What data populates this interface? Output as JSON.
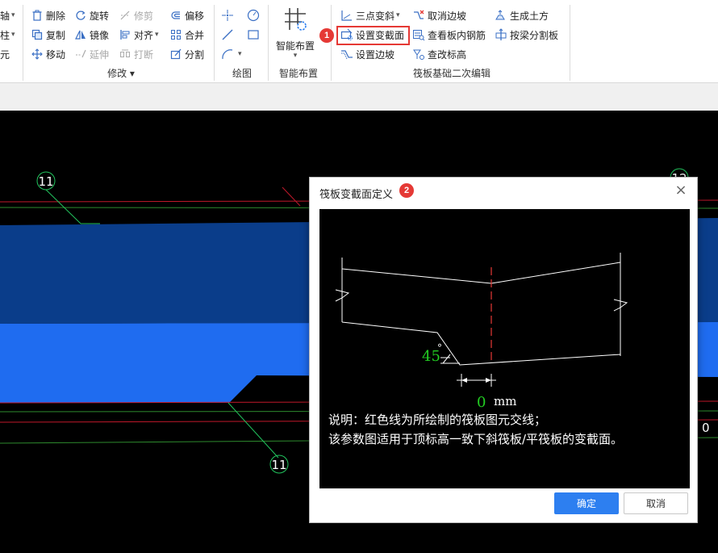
{
  "ribbon": {
    "left_cut_labels": [
      "轴",
      "柱",
      "元"
    ],
    "modify": {
      "delete": "删除",
      "rotate": "旋转",
      "trim": "修剪",
      "offset": "偏移",
      "copy": "复制",
      "mirror": "镜像",
      "align": "对齐",
      "merge": "合并",
      "move": "移动",
      "extend": "延伸",
      "break": "打断",
      "split": "分割",
      "group_label": "修改"
    },
    "draw": {
      "group_label": "绘图"
    },
    "smart": {
      "button_label": "智能布置",
      "group_label": "智能布置"
    },
    "raft_edit": {
      "three_point_slope": "三点变斜",
      "cancel_slope": "取消边坡",
      "generate_earthwork": "生成土方",
      "set_section": "设置变截面",
      "view_rebar": "查看板内钢筋",
      "split_by_beam": "按梁分割板",
      "set_slope": "设置边坡",
      "edit_elevation": "查改标高",
      "group_label": "筏板基础二次编辑"
    },
    "badge_1": "1"
  },
  "canvas": {
    "axis_label_left_top": "11",
    "axis_label_bottom": "11",
    "axis_label_right_top": "12",
    "axis_label_right_edge": "0"
  },
  "dialog": {
    "title": "筏板变截面定义",
    "badge_2": "2",
    "close_symbol": "×",
    "angle_value": "45",
    "degree_symbol": "°",
    "offset_value": "0",
    "offset_unit": "mm",
    "note_line1": "说明：红色线为所绘制的筏板图元交线；",
    "note_line2": "该参数图适用于顶标高一致下斜筏板/平筏板的变截面。",
    "ok_label": "确定",
    "cancel_label": "取消"
  },
  "colors": {
    "accent": "#2d7ff0",
    "highlight": "#e53935",
    "slab_dark": "#0a3d8a",
    "slab_bright": "#1f6cf0",
    "axis_green": "#22c55e",
    "dim_green": "#22cc22",
    "section_red": "#e53935"
  }
}
